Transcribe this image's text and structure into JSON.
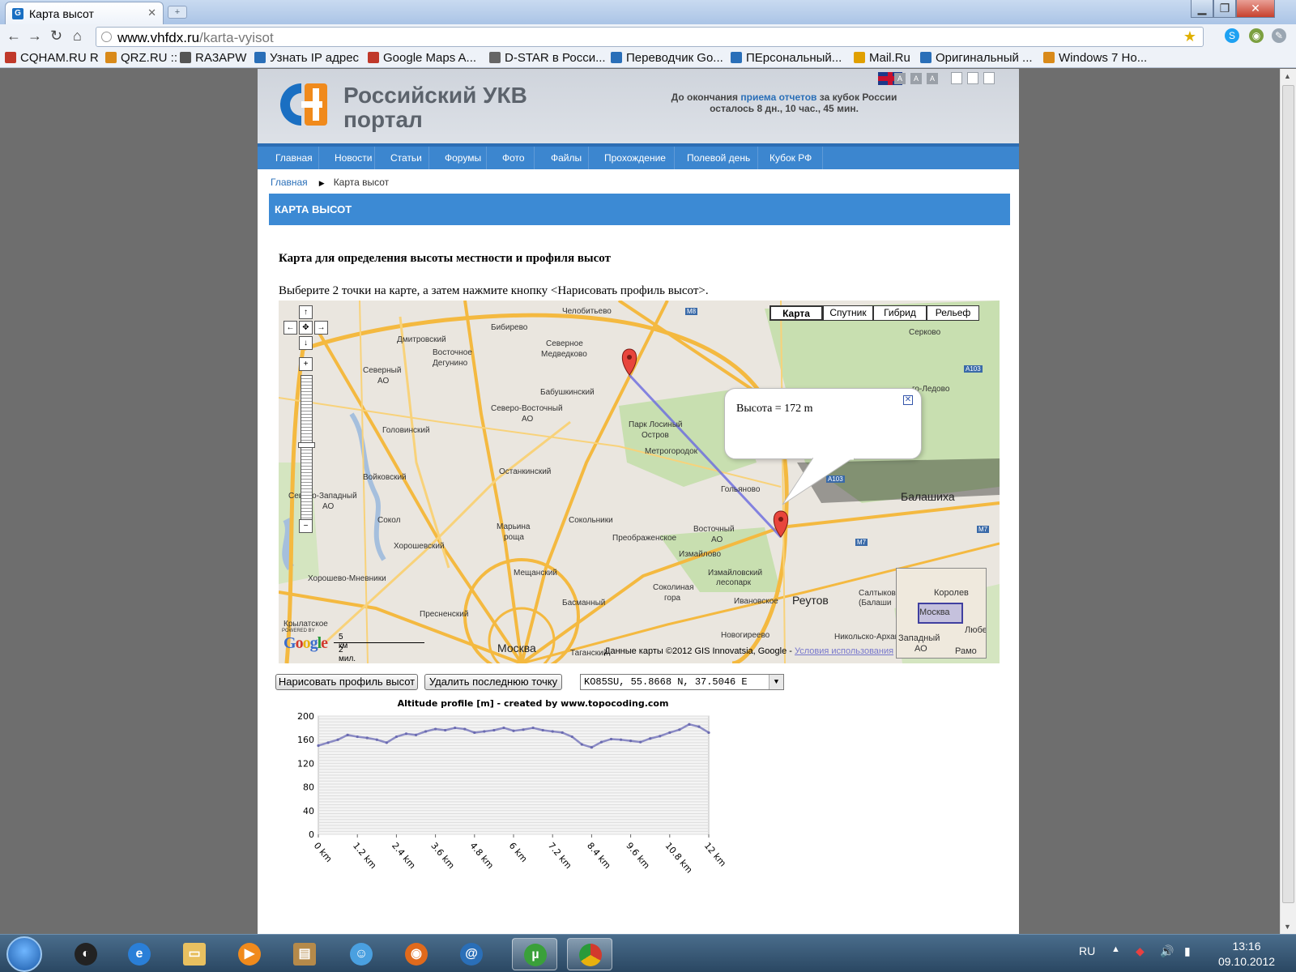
{
  "browser": {
    "tab_title": "Карта высот",
    "tab_favicon": "G",
    "url_domain": "www.vhfdx.ru",
    "url_path": "/karta-vyisot",
    "bookmarks": [
      {
        "label": "CQHAM.RU R",
        "color": "#c0392b"
      },
      {
        "label": "QRZ.RU ::",
        "color": "#d98a1a"
      },
      {
        "label": "RA3APW",
        "color": "#555555"
      },
      {
        "label": "Узнать IP адрес",
        "color": "#2a6fb8"
      },
      {
        "label": "Google Maps A...",
        "color": "#c0392b"
      },
      {
        "label": "D-STAR в Росси...",
        "color": "#666666"
      },
      {
        "label": "Переводчик Go...",
        "color": "#2a6fb8"
      },
      {
        "label": "ПЕрсональный...",
        "color": "#2a6fb8"
      },
      {
        "label": "Mail.Ru",
        "color": "#e0a000"
      },
      {
        "label": "Оригинальный ...",
        "color": "#2a6fb8"
      },
      {
        "label": "Windows 7 Но...",
        "color": "#d98a1a"
      }
    ]
  },
  "site": {
    "logo_line1": "Российский УКВ",
    "logo_line2": "портал",
    "countdown_prefix": "До окончания",
    "countdown_link": "приема отчетов",
    "countdown_suffix": "за кубок России",
    "countdown_line2": "осталось 8 дн., 10 час., 45 мин.",
    "font_size_labels": [
      "A",
      "A",
      "A"
    ],
    "menu": [
      "Главная",
      "Новости",
      "Статьи",
      "Форумы",
      "Фото",
      "Файлы",
      "Прохождение",
      "Полевой день",
      "Кубок РФ"
    ],
    "breadcrumb_home": "Главная",
    "breadcrumb_current": "Карта высот",
    "page_heading": "КАРТА ВЫСОТ",
    "subtitle": "Карта для определения высоты местности и профиля высот",
    "instructions": "Выберите 2 точки на карте, а затем нажмите кнопку <Нарисовать профиль высот>.",
    "accent_color": "#3c8ad4"
  },
  "map": {
    "map_types": [
      "Карта",
      "Спутник",
      "Гибрид",
      "Рельеф"
    ],
    "active_map_type": "Карта",
    "bubble_text": "Высота = 172 m",
    "labels": [
      {
        "t": "Челобитьево",
        "x": 350,
        "y": 8
      },
      {
        "t": "Бибирево",
        "x": 262,
        "y": 28
      },
      {
        "t": "Дмитровский",
        "x": 146,
        "y": 43
      },
      {
        "t": "Северное",
        "x": 330,
        "y": 48
      },
      {
        "t": "Медведково",
        "x": 324,
        "y": 61
      },
      {
        "t": "Восточное",
        "x": 190,
        "y": 59
      },
      {
        "t": "Дегунино",
        "x": 190,
        "y": 72
      },
      {
        "t": "Серково",
        "x": 778,
        "y": 34
      },
      {
        "t": "Северный",
        "x": 104,
        "y": 81
      },
      {
        "t": "АО",
        "x": 122,
        "y": 94
      },
      {
        "t": "Бабушкинский",
        "x": 323,
        "y": 108
      },
      {
        "t": "Северо-Восточный",
        "x": 262,
        "y": 128
      },
      {
        "t": "АО",
        "x": 300,
        "y": 141
      },
      {
        "t": "Парк Лосиный",
        "x": 432,
        "y": 148
      },
      {
        "t": "Остров",
        "x": 448,
        "y": 161
      },
      {
        "t": "Головинский",
        "x": 128,
        "y": 155
      },
      {
        "t": "Метрогородок",
        "x": 452,
        "y": 181
      },
      {
        "t": "Останкинский",
        "x": 272,
        "y": 206
      },
      {
        "t": "Войковский",
        "x": 104,
        "y": 213
      },
      {
        "t": "Гольяново",
        "x": 546,
        "y": 228
      },
      {
        "t": "Северо-Западный",
        "x": 12,
        "y": 236
      },
      {
        "t": "АО",
        "x": 54,
        "y": 249
      },
      {
        "t": "Сокол",
        "x": 122,
        "y": 266
      },
      {
        "t": "Сокольники",
        "x": 358,
        "y": 266
      },
      {
        "t": "Марьина",
        "x": 269,
        "y": 274
      },
      {
        "t": "роща",
        "x": 278,
        "y": 287
      },
      {
        "t": "Восточный",
        "x": 512,
        "y": 277
      },
      {
        "t": "АО",
        "x": 534,
        "y": 290
      },
      {
        "t": "Преображенское",
        "x": 412,
        "y": 288
      },
      {
        "t": "Хорошевский",
        "x": 142,
        "y": 298
      },
      {
        "t": "Измайлово",
        "x": 494,
        "y": 308
      },
      {
        "t": "Мещанский",
        "x": 290,
        "y": 331
      },
      {
        "t": "Измайловский",
        "x": 530,
        "y": 331
      },
      {
        "t": "лесопарк",
        "x": 540,
        "y": 343
      },
      {
        "t": "Хорошево-Мневники",
        "x": 36,
        "y": 338
      },
      {
        "t": "Соколиная",
        "x": 462,
        "y": 349
      },
      {
        "t": "гора",
        "x": 476,
        "y": 362
      },
      {
        "t": "Басманный",
        "x": 350,
        "y": 368
      },
      {
        "t": "Ивановское",
        "x": 562,
        "y": 366
      },
      {
        "t": "Пресненский",
        "x": 174,
        "y": 382
      },
      {
        "t": "Крылатское",
        "x": 6,
        "y": 394
      },
      {
        "t": "Новогиреево",
        "x": 546,
        "y": 408
      },
      {
        "t": "Таганский",
        "x": 360,
        "y": 430
      },
      {
        "t": "Салтыков",
        "x": 716,
        "y": 356
      },
      {
        "t": "(Балаши",
        "x": 716,
        "y": 368
      },
      {
        "t": "Никольско-Архангe",
        "x": 686,
        "y": 410
      },
      {
        "t": "го-Ледово",
        "x": 782,
        "y": 104
      }
    ],
    "big_labels": [
      {
        "t": "Реутов",
        "x": 634,
        "y": 362
      },
      {
        "t": "Балашиха",
        "x": 768,
        "y": 234
      },
      {
        "t": "Москва",
        "x": 270,
        "y": 421
      }
    ],
    "road_labels": [
      {
        "t": "M8",
        "x": 502,
        "y": 9
      },
      {
        "t": "A103",
        "x": 846,
        "y": 80
      },
      {
        "t": "A103",
        "x": 676,
        "y": 216
      },
      {
        "t": "M7",
        "x": 712,
        "y": 294
      },
      {
        "t": "M7",
        "x": 862,
        "y": 278
      }
    ],
    "minimap_labels": [
      "Королев",
      "Москва",
      "Западный",
      "АО",
      "Любер",
      "Рамо"
    ],
    "powered_by": "POWERED BY",
    "google": "Google",
    "scale_km": "5 км",
    "scale_mi": "2 мил.",
    "attribution": "Данные карты ©2012 GIS Innovatsia, Google -",
    "terms": "Условия использования"
  },
  "controls": {
    "draw_button": "Нарисовать профиль высот",
    "delete_button": "Удалить последнюю точку",
    "point_select": "KO85SU, 55.8668 N, 37.5046 E"
  },
  "chart_data": {
    "type": "area",
    "title": "Altitude profile [m] - created by www.topocoding.com",
    "xlabel": "",
    "ylabel": "",
    "x_ticks": [
      "0 km",
      "1.2 km",
      "2.4 km",
      "3.6 km",
      "4.8 km",
      "6 km",
      "7.2 km",
      "8.4 km",
      "9.6 km",
      "10.8 km",
      "12 km"
    ],
    "y_ticks": [
      0,
      40,
      80,
      120,
      160,
      200
    ],
    "ylim": [
      0,
      200
    ],
    "xlim": [
      0,
      12
    ],
    "color": "#8a8ac4",
    "x": [
      0,
      0.3,
      0.6,
      0.9,
      1.2,
      1.5,
      1.8,
      2.1,
      2.4,
      2.7,
      3.0,
      3.3,
      3.6,
      3.9,
      4.2,
      4.5,
      4.8,
      5.1,
      5.4,
      5.7,
      6.0,
      6.3,
      6.6,
      6.9,
      7.2,
      7.5,
      7.8,
      8.1,
      8.4,
      8.7,
      9.0,
      9.3,
      9.6,
      9.9,
      10.2,
      10.5,
      10.8,
      11.1,
      11.4,
      11.7,
      12.0
    ],
    "values": [
      150,
      155,
      160,
      168,
      165,
      163,
      160,
      155,
      165,
      170,
      168,
      174,
      178,
      176,
      180,
      178,
      172,
      174,
      176,
      180,
      175,
      177,
      180,
      176,
      174,
      172,
      165,
      152,
      147,
      156,
      161,
      160,
      158,
      156,
      162,
      166,
      172,
      177,
      186,
      182,
      172
    ]
  },
  "taskbar": {
    "lang": "RU",
    "time": "13:16",
    "date": "09.10.2012"
  }
}
